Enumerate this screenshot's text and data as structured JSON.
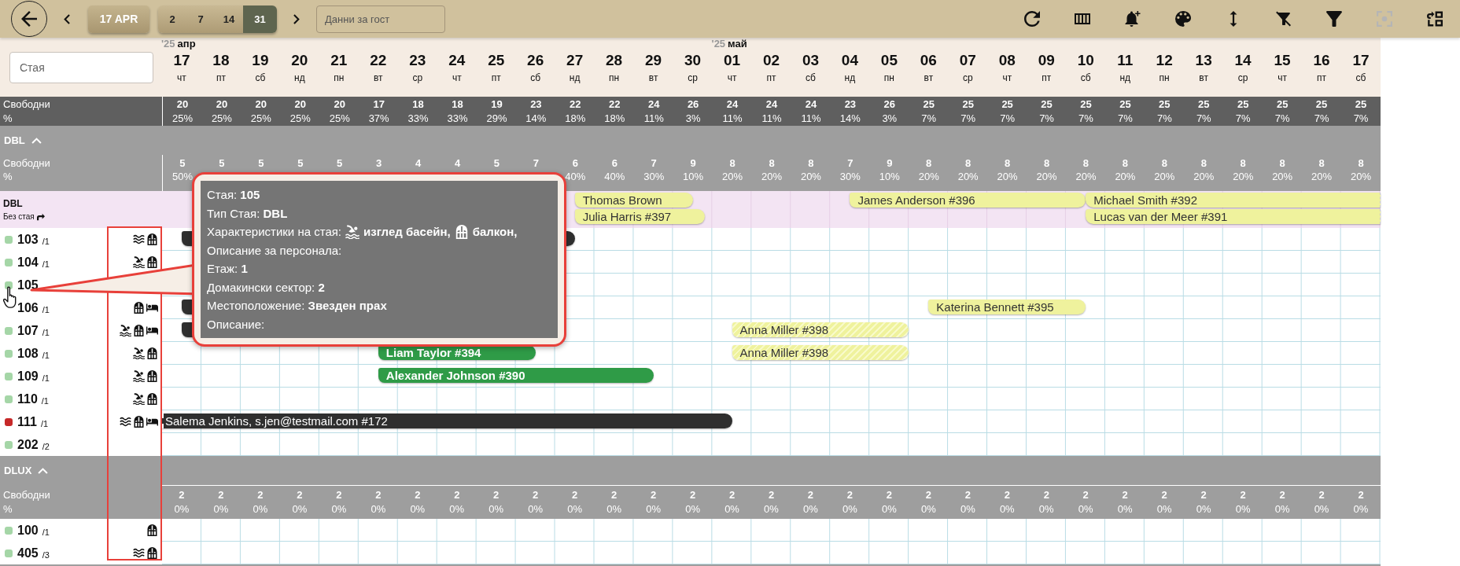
{
  "toolbar": {
    "today": "17 APR",
    "ranges": [
      {
        "label": "2",
        "selected": false
      },
      {
        "label": "7",
        "selected": false
      },
      {
        "label": "14",
        "selected": false
      },
      {
        "label": "31",
        "selected": true
      }
    ],
    "guest_search": {
      "placeholder": "Данни за гост"
    },
    "actions": [
      {
        "kind": "refresh",
        "disabled": false
      },
      {
        "kind": "columns",
        "disabled": false
      },
      {
        "kind": "bell_plus",
        "disabled": false
      },
      {
        "kind": "palette",
        "disabled": false
      },
      {
        "kind": "height",
        "disabled": false
      },
      {
        "kind": "filter_off",
        "disabled": false
      },
      {
        "kind": "filter",
        "disabled": false
      },
      {
        "kind": "focus",
        "disabled": true
      },
      {
        "kind": "move",
        "disabled": false
      }
    ]
  },
  "room_search": {
    "placeholder": "Стая"
  },
  "days": [
    {
      "day": "17",
      "weekday": "чт",
      "month": {
        "year": "'25",
        "name": "апр"
      }
    },
    {
      "day": "18",
      "weekday": "пт"
    },
    {
      "day": "19",
      "weekday": "сб"
    },
    {
      "day": "20",
      "weekday": "нд"
    },
    {
      "day": "21",
      "weekday": "пн"
    },
    {
      "day": "22",
      "weekday": "вт"
    },
    {
      "day": "23",
      "weekday": "ср"
    },
    {
      "day": "24",
      "weekday": "чт"
    },
    {
      "day": "25",
      "weekday": "пт"
    },
    {
      "day": "26",
      "weekday": "сб"
    },
    {
      "day": "27",
      "weekday": "нд"
    },
    {
      "day": "28",
      "weekday": "пн"
    },
    {
      "day": "29",
      "weekday": "вт"
    },
    {
      "day": "30",
      "weekday": "ср"
    },
    {
      "day": "01",
      "weekday": "чт",
      "month": {
        "year": "'25",
        "name": "май"
      }
    },
    {
      "day": "02",
      "weekday": "пт"
    },
    {
      "day": "03",
      "weekday": "сб"
    },
    {
      "day": "04",
      "weekday": "нд"
    },
    {
      "day": "05",
      "weekday": "пн"
    },
    {
      "day": "06",
      "weekday": "вт"
    },
    {
      "day": "07",
      "weekday": "ср"
    },
    {
      "day": "08",
      "weekday": "чт"
    },
    {
      "day": "09",
      "weekday": "пт"
    },
    {
      "day": "10",
      "weekday": "сб"
    },
    {
      "day": "11",
      "weekday": "нд"
    },
    {
      "day": "12",
      "weekday": "пн"
    },
    {
      "day": "13",
      "weekday": "вт"
    },
    {
      "day": "14",
      "weekday": "ср"
    },
    {
      "day": "15",
      "weekday": "чт"
    },
    {
      "day": "16",
      "weekday": "пт"
    },
    {
      "day": "17",
      "weekday": "сб"
    }
  ],
  "total_free": {
    "label": "Свободни",
    "sublabel": "%",
    "values": [
      {
        "count": "20",
        "pct": "25%"
      },
      {
        "count": "20",
        "pct": "25%"
      },
      {
        "count": "20",
        "pct": "25%"
      },
      {
        "count": "20",
        "pct": "25%"
      },
      {
        "count": "20",
        "pct": "25%"
      },
      {
        "count": "17",
        "pct": "37%"
      },
      {
        "count": "18",
        "pct": "33%"
      },
      {
        "count": "18",
        "pct": "33%"
      },
      {
        "count": "19",
        "pct": "29%"
      },
      {
        "count": "23",
        "pct": "14%"
      },
      {
        "count": "22",
        "pct": "18%"
      },
      {
        "count": "22",
        "pct": "18%"
      },
      {
        "count": "24",
        "pct": "11%"
      },
      {
        "count": "26",
        "pct": "3%"
      },
      {
        "count": "24",
        "pct": "11%"
      },
      {
        "count": "24",
        "pct": "11%"
      },
      {
        "count": "24",
        "pct": "11%"
      },
      {
        "count": "23",
        "pct": "14%"
      },
      {
        "count": "26",
        "pct": "3%"
      },
      {
        "count": "25",
        "pct": "7%"
      },
      {
        "count": "25",
        "pct": "7%"
      },
      {
        "count": "25",
        "pct": "7%"
      },
      {
        "count": "25",
        "pct": "7%"
      },
      {
        "count": "25",
        "pct": "7%"
      },
      {
        "count": "25",
        "pct": "7%"
      },
      {
        "count": "25",
        "pct": "7%"
      },
      {
        "count": "25",
        "pct": "7%"
      },
      {
        "count": "25",
        "pct": "7%"
      },
      {
        "count": "25",
        "pct": "7%"
      },
      {
        "count": "25",
        "pct": "7%"
      },
      {
        "count": "25",
        "pct": "7%"
      }
    ]
  },
  "groups": [
    {
      "name": "DBL",
      "expanded": true,
      "free": {
        "label": "Свободни",
        "sublabel": "%",
        "values": [
          {
            "count": "5",
            "pct": "50%"
          },
          {
            "count": "5"
          },
          {
            "count": "5"
          },
          {
            "count": "5"
          },
          {
            "count": "5"
          },
          {
            "count": "3"
          },
          {
            "count": "4"
          },
          {
            "count": "4"
          },
          {
            "count": "5"
          },
          {
            "count": "7"
          },
          {
            "count": "6",
            "pct": "40%"
          },
          {
            "count": "6",
            "pct": "40%"
          },
          {
            "count": "7",
            "pct": "30%"
          },
          {
            "count": "9",
            "pct": "10%"
          },
          {
            "count": "8",
            "pct": "20%"
          },
          {
            "count": "8",
            "pct": "20%"
          },
          {
            "count": "8",
            "pct": "20%"
          },
          {
            "count": "7",
            "pct": "30%"
          },
          {
            "count": "9",
            "pct": "10%"
          },
          {
            "count": "8",
            "pct": "20%"
          },
          {
            "count": "8",
            "pct": "20%"
          },
          {
            "count": "8",
            "pct": "20%"
          },
          {
            "count": "8",
            "pct": "20%"
          },
          {
            "count": "8",
            "pct": "20%"
          },
          {
            "count": "8",
            "pct": "20%"
          },
          {
            "count": "8",
            "pct": "20%"
          },
          {
            "count": "8",
            "pct": "20%"
          },
          {
            "count": "8",
            "pct": "20%"
          },
          {
            "count": "8",
            "pct": "20%"
          },
          {
            "count": "8",
            "pct": "20%"
          },
          {
            "count": "8",
            "pct": "20%"
          }
        ]
      },
      "unassigned": {
        "type": "DBL",
        "label": "Без стая",
        "lanes": [
          [
            {
              "label": "Thomas Brown",
              "kind": "pending"
            },
            {
              "label": "James Anderson #396",
              "kind": "pending"
            },
            {
              "label": "Michael Smith #392",
              "kind": "pending"
            }
          ],
          [
            {
              "label": "Julia Harris #397",
              "kind": "pending"
            },
            {
              "label": "Lucas van der Meer #391",
              "kind": "pending"
            }
          ]
        ]
      },
      "rooms": [
        {
          "number": "103",
          "floor": "/1",
          "color": "#a5d6a7",
          "features": [
            {
              "kind": "waves"
            },
            {
              "kind": "balcony"
            }
          ],
          "bookings": [
            {
              "kind": "dark"
            }
          ]
        },
        {
          "number": "104",
          "floor": "/1",
          "color": "#a5d6a7",
          "features": [
            {
              "kind": "pool"
            },
            {
              "kind": "balcony"
            }
          ]
        },
        {
          "number": "105",
          "color": "#a5d6a7"
        },
        {
          "number": "106",
          "floor": "/1",
          "features": [
            {
              "kind": "balcony"
            },
            {
              "kind": "bed"
            }
          ],
          "bookings": [
            {
              "kind": "dark"
            },
            {
              "label": "Katerina Bennett #395",
              "kind": "pending"
            }
          ]
        },
        {
          "number": "107",
          "floor": "/1",
          "color": "#a5d6a7",
          "features": [
            {
              "kind": "pool"
            },
            {
              "kind": "balcony"
            },
            {
              "kind": "bed"
            }
          ],
          "bookings": [
            {
              "kind": "dark"
            },
            {
              "label": "Anna Miller #398",
              "kind": "pending_striped"
            }
          ]
        },
        {
          "number": "108",
          "floor": "/1",
          "color": "#a5d6a7",
          "features": [
            {
              "kind": "pool"
            },
            {
              "kind": "balcony"
            }
          ],
          "bookings": [
            {
              "label": "Liam Taylor #394",
              "kind": "green"
            },
            {
              "label": "Anna Miller #398",
              "kind": "pending_striped"
            }
          ]
        },
        {
          "number": "109",
          "floor": "/1",
          "color": "#a5d6a7",
          "features": [
            {
              "kind": "pool"
            },
            {
              "kind": "balcony"
            }
          ],
          "bookings": [
            {
              "label": "Alexander Johnson #390",
              "kind": "green"
            }
          ]
        },
        {
          "number": "110",
          "floor": "/1",
          "color": "#a5d6a7",
          "features": [
            {
              "kind": "pool"
            },
            {
              "kind": "balcony"
            }
          ]
        },
        {
          "number": "111",
          "floor": "/1",
          "color": "#c62828",
          "features": [
            {
              "kind": "waves"
            },
            {
              "kind": "balcony"
            },
            {
              "kind": "bed"
            }
          ],
          "bookings": [
            {
              "label": "Salema Jenkins, s.jen@testmail.com #172",
              "kind": "dark"
            }
          ]
        },
        {
          "number": "202",
          "floor": "/2",
          "color": "#a5d6a7"
        }
      ]
    },
    {
      "name": "DLUX",
      "expanded": true,
      "free": {
        "label": "Свободни",
        "sublabel": "%",
        "values": [
          {
            "count": "2",
            "pct": "0%"
          },
          {
            "count": "2",
            "pct": "0%"
          },
          {
            "count": "2",
            "pct": "0%"
          },
          {
            "count": "2",
            "pct": "0%"
          },
          {
            "count": "2",
            "pct": "0%"
          },
          {
            "count": "2",
            "pct": "0%"
          },
          {
            "count": "2",
            "pct": "0%"
          },
          {
            "count": "2",
            "pct": "0%"
          },
          {
            "count": "2",
            "pct": "0%"
          },
          {
            "count": "2",
            "pct": "0%"
          },
          {
            "count": "2",
            "pct": "0%"
          },
          {
            "count": "2",
            "pct": "0%"
          },
          {
            "count": "2",
            "pct": "0%"
          },
          {
            "count": "2",
            "pct": "0%"
          },
          {
            "count": "2",
            "pct": "0%"
          },
          {
            "count": "2",
            "pct": "0%"
          },
          {
            "count": "2",
            "pct": "0%"
          },
          {
            "count": "2",
            "pct": "0%"
          },
          {
            "count": "2",
            "pct": "0%"
          },
          {
            "count": "2",
            "pct": "0%"
          },
          {
            "count": "2",
            "pct": "0%"
          },
          {
            "count": "2",
            "pct": "0%"
          },
          {
            "count": "2",
            "pct": "0%"
          },
          {
            "count": "2",
            "pct": "0%"
          },
          {
            "count": "2",
            "pct": "0%"
          },
          {
            "count": "2",
            "pct": "0%"
          },
          {
            "count": "2",
            "pct": "0%"
          },
          {
            "count": "2",
            "pct": "0%"
          },
          {
            "count": "2",
            "pct": "0%"
          },
          {
            "count": "2",
            "pct": "0%"
          },
          {
            "count": "2",
            "pct": "0%"
          }
        ]
      },
      "rooms": [
        {
          "number": "100",
          "floor": "/1",
          "color": "#a5d6a7",
          "features": [
            {
              "kind": "balcony"
            }
          ]
        },
        {
          "number": "405",
          "floor": "/3",
          "color": "#a5d6a7",
          "features": [
            {
              "kind": "waves"
            },
            {
              "kind": "balcony"
            }
          ]
        }
      ]
    }
  ],
  "tooltip": {
    "lines": [
      {
        "text": "Стая: **105**"
      },
      {
        "text": "Тип Стая: **DBL**"
      },
      {
        "label": "Характеристики на стая:",
        "features": [
          {
            "kind": "pool",
            "text": "изглед басейн,"
          },
          {
            "kind": "balcony",
            "text": "балкон,"
          }
        ]
      },
      {
        "text": "Описание за персонала:"
      },
      {
        "text": "Етаж: **1**"
      },
      {
        "text": "Домакински сектор: **2**"
      },
      {
        "text": "Местоположение: **Звезден прах**"
      },
      {
        "text": "Описание:"
      }
    ]
  }
}
